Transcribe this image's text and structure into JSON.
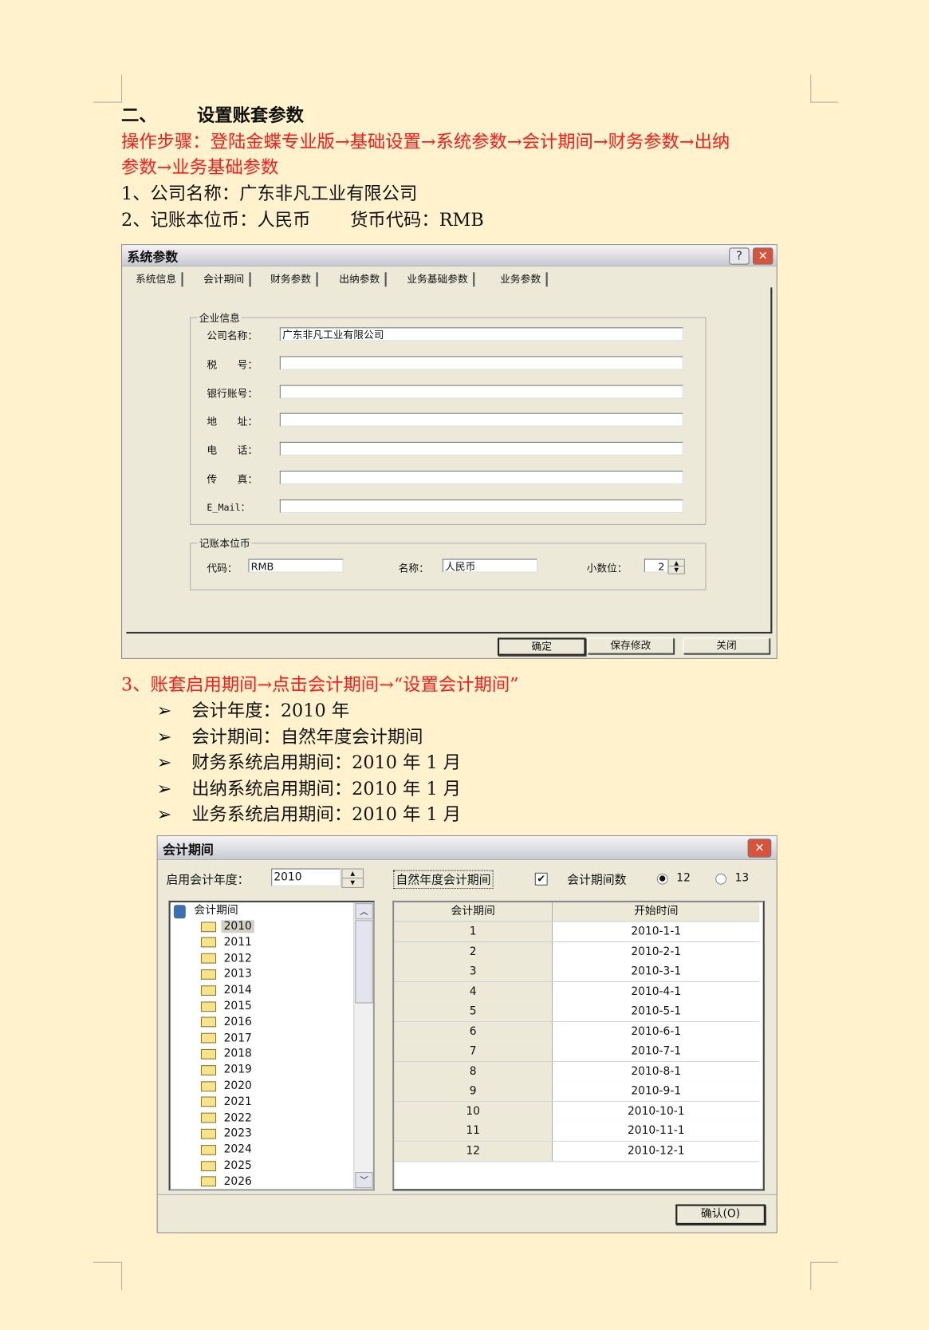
{
  "heading": {
    "number": "二、",
    "title": "设置账套参数"
  },
  "steps": {
    "line1": "操作步骤：登陆金蝶专业版→基础设置→系统参数→会计期间→财务参数→出纳",
    "line2": "参数→业务基础参数"
  },
  "items": {
    "company": "1、公司名称：广东非凡工业有限公司",
    "currency": "2、记账本位币：人民币",
    "currency_code": "货币代码：RMB"
  },
  "sys_dialog": {
    "title": "系统参数",
    "help_icon": "?",
    "close_icon": "✕",
    "tabs": [
      "系统信息",
      "会计期间",
      "财务参数",
      "出纳参数",
      "业务基础参数",
      "业务参数"
    ],
    "company_group": "企业信息",
    "fields": [
      {
        "label": "公司名称：",
        "value": "广东非凡工业有限公司"
      },
      {
        "label": "税　　号：",
        "value": ""
      },
      {
        "label": "银行账号：",
        "value": ""
      },
      {
        "label": "地　　址：",
        "value": ""
      },
      {
        "label": "电　　话：",
        "value": ""
      },
      {
        "label": "传　　真：",
        "value": ""
      },
      {
        "label": "E_Mail：",
        "value": ""
      }
    ],
    "currency_group": "记账本位币",
    "code_label": "代码：",
    "code_value": "RMB",
    "name_label": "名称：",
    "name_value": "人民币",
    "decimals_label": "小数位：",
    "decimals_value": "2",
    "buttons": {
      "ok": "确定",
      "save": "保存修改",
      "close": "关闭"
    }
  },
  "step3": "3、账套启用期间→点击会计期间→“设置会计期间”",
  "bullets": [
    "会计年度：2010 年",
    "会计期间：自然年度会计期间",
    "财务系统启用期间：2010 年 1 月",
    "出纳系统启用期间：2010 年 1 月",
    "业务系统启用期间：2010 年 1 月"
  ],
  "bullet_icon": "➢",
  "period_dialog": {
    "title": "会计期间",
    "close_icon": "✕",
    "year_label": "启用会计年度：",
    "year_value": "2010",
    "natural_year": "自然年度会计期间",
    "natural_checked": true,
    "count_label": "会计期间数",
    "radio_12": "12",
    "radio_13": "13",
    "selected_count": "12",
    "tree_root": "会计期间",
    "tree_years": [
      "2010",
      "2011",
      "2012",
      "2013",
      "2014",
      "2015",
      "2016",
      "2017",
      "2018",
      "2019",
      "2020",
      "2021",
      "2022",
      "2023",
      "2024",
      "2025",
      "2026"
    ],
    "selected_year": "2010",
    "table_headers": [
      "会计期间",
      "开始时间"
    ],
    "rows": [
      [
        "1",
        "2010-1-1"
      ],
      [
        "2",
        "2010-2-1"
      ],
      [
        "3",
        "2010-3-1"
      ],
      [
        "4",
        "2010-4-1"
      ],
      [
        "5",
        "2010-5-1"
      ],
      [
        "6",
        "2010-6-1"
      ],
      [
        "7",
        "2010-7-1"
      ],
      [
        "8",
        "2010-8-1"
      ],
      [
        "9",
        "2010-9-1"
      ],
      [
        "10",
        "2010-10-1"
      ],
      [
        "11",
        "2010-11-1"
      ],
      [
        "12",
        "2010-12-1"
      ]
    ],
    "confirm": "确认(O)"
  }
}
